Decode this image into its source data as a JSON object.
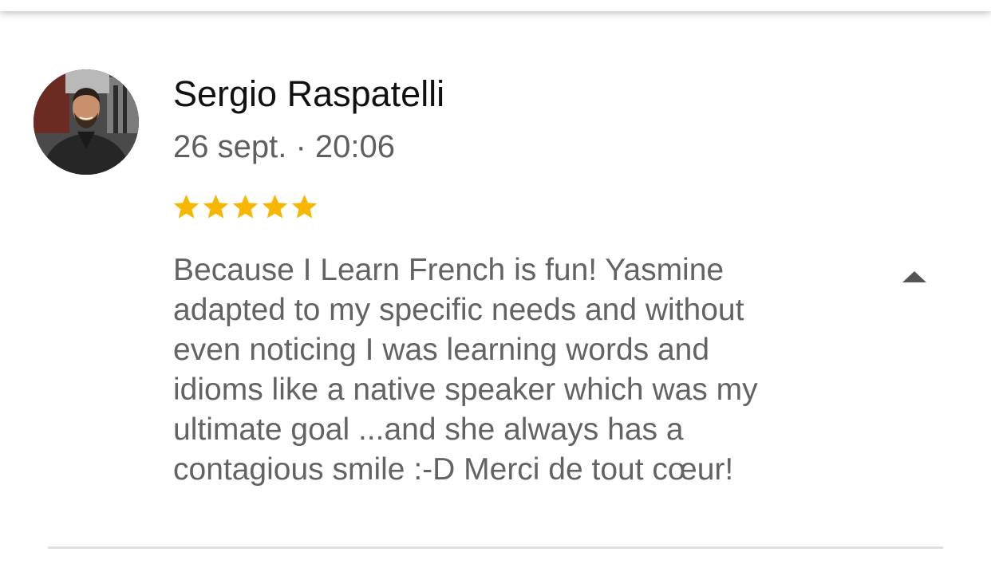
{
  "review": {
    "reviewer_name": "Sergio Raspatelli",
    "date": "26 sept. · 20:06",
    "rating": 5,
    "rating_max": 5,
    "text": "Because I Learn French is fun! Yasmine\nadapted to my specific needs and without\neven noticing I was learning words and\nidioms like a native speaker which was my\nultimate goal ...and she always has a\ncontagious smile :-D Merci de tout cœur!"
  },
  "icons": {
    "avatar": "avatar-photo",
    "star": "star-icon",
    "collapse": "caret-up-icon"
  },
  "colors": {
    "star": "#F7B600",
    "name": "#111111",
    "secondary_text": "#636363",
    "divider": "#E0E0E0"
  }
}
